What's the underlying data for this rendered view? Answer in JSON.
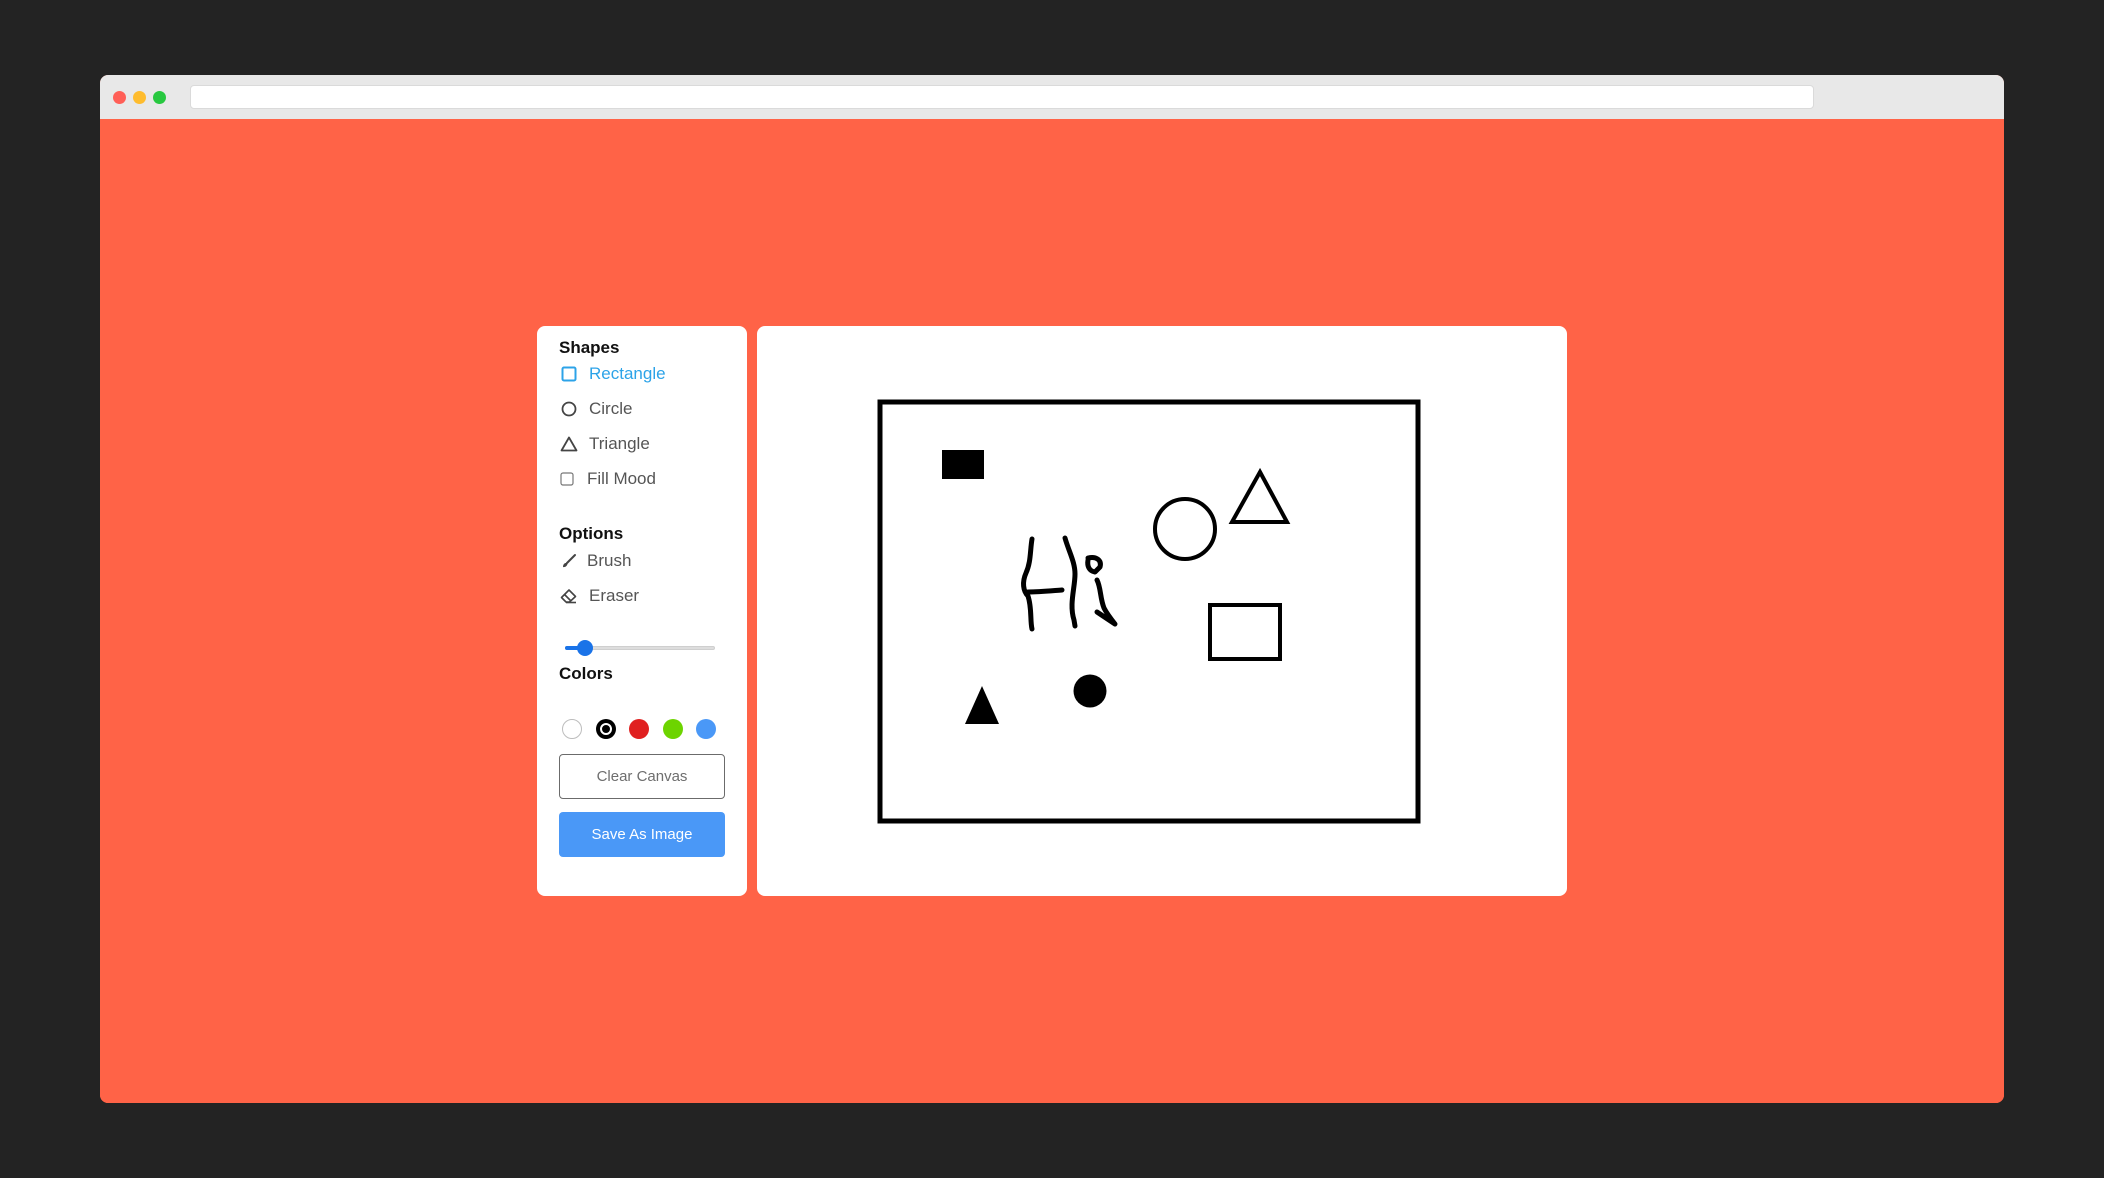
{
  "window": {
    "url": ""
  },
  "tools": {
    "shapes_title": "Shapes",
    "shapes": [
      {
        "label": "Rectangle",
        "icon": "square-outline-icon",
        "active": true
      },
      {
        "label": "Circle",
        "icon": "circle-outline-icon",
        "active": false
      },
      {
        "label": "Triangle",
        "icon": "triangle-outline-icon",
        "active": false
      }
    ],
    "fill_label": "Fill Mood",
    "fill_checked": false,
    "options_title": "Options",
    "options": [
      {
        "label": "Brush",
        "icon": "brush-icon"
      },
      {
        "label": "Eraser",
        "icon": "eraser-icon"
      }
    ],
    "brush_size_fraction": 0.13,
    "colors_title": "Colors",
    "colors": [
      "#FFFFFF",
      "#000000",
      "#E02020",
      "#6DD400",
      "#4A98F7"
    ],
    "selected_color_index": 1,
    "clear_label": "Clear Canvas",
    "save_label": "Save As Image"
  },
  "theme": {
    "background": "#FF6347",
    "accent": "#4A98F7",
    "active_tool": "#2CA3E8"
  }
}
